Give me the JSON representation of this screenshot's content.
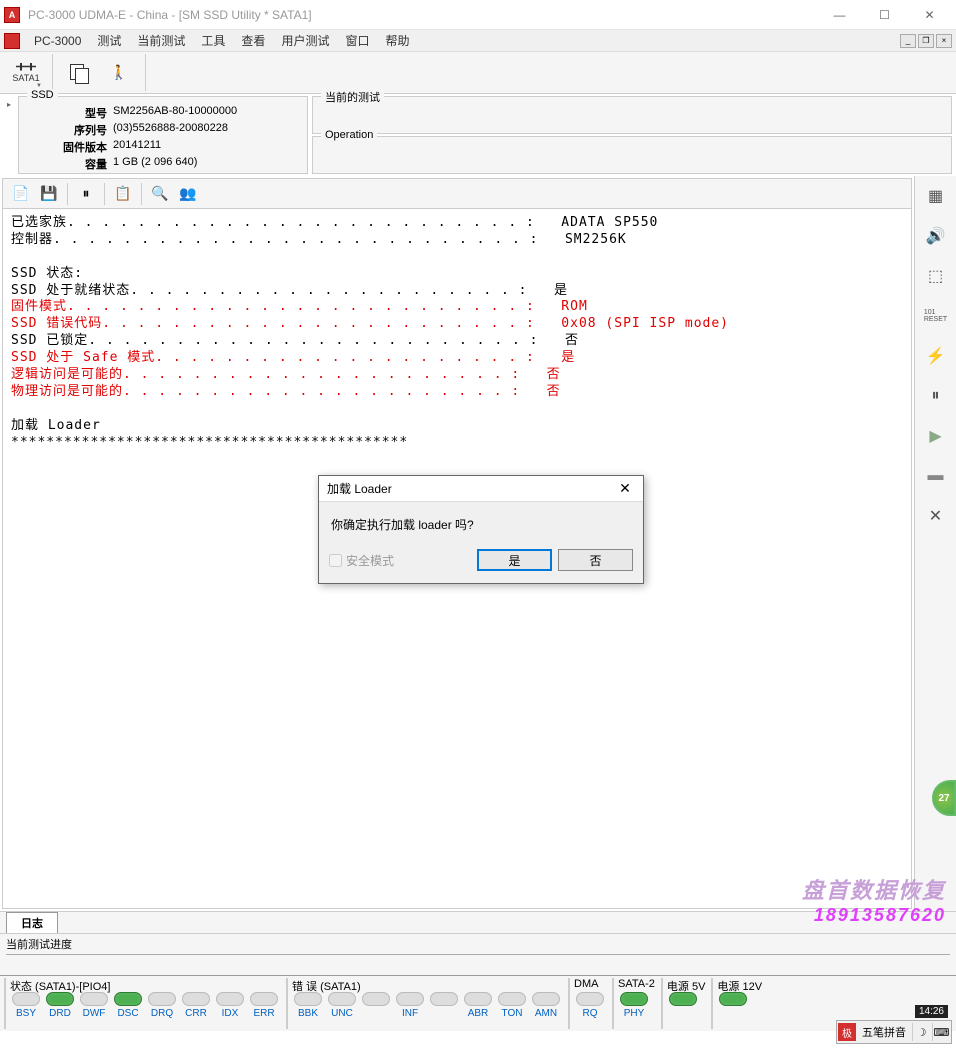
{
  "window": {
    "title": "PC-3000 UDMA-E - China - [SM SSD Utility * SATA1]",
    "minimize": "—",
    "maximize": "☐",
    "close": "✕"
  },
  "menubar": {
    "app_label": "PC-3000",
    "items": [
      "测试",
      "当前测试",
      "工具",
      "查看",
      "用户测试",
      "窗口",
      "帮助"
    ],
    "mdi_min": "_",
    "mdi_restore": "❐",
    "mdi_close": "×"
  },
  "toolbar": {
    "sata_label": "SATA1"
  },
  "ssd_info": {
    "panel_title": "SSD",
    "rows": [
      {
        "label": "型号",
        "value": "SM2256AB-80-10000000"
      },
      {
        "label": "序列号",
        "value": "(03)5526888-20080228"
      },
      {
        "label": "固件版本",
        "value": "20141211"
      },
      {
        "label": "容量",
        "value": "1 GB (2 096 640)"
      }
    ]
  },
  "test_panels": {
    "current_test": "当前的测试",
    "operation": "Operation"
  },
  "log": {
    "lines": [
      {
        "text": "已选家族. . . . . . . . . . . . . . . . . . . . . . . . . . :   ADATA SP550",
        "cls": ""
      },
      {
        "text": "控制器. . . . . . . . . . . . . . . . . . . . . . . . . . . :   SM2256K",
        "cls": ""
      },
      {
        "text": "",
        "cls": ""
      },
      {
        "text": "SSD 状态:",
        "cls": ""
      },
      {
        "text": "SSD 处于就绪状态. . . . . . . . . . . . . . . . . . . . . . :   是",
        "cls": ""
      },
      {
        "text": "固件模式. . . . . . . . . . . . . . . . . . . . . . . . . . :   ROM",
        "cls": "red"
      },
      {
        "text": "SSD 错误代码. . . . . . . . . . . . . . . . . . . . . . . . :   0x08 (SPI ISP mode)",
        "cls": "red"
      },
      {
        "text": "SSD 已锁定. . . . . . . . . . . . . . . . . . . . . . . . . :   否",
        "cls": ""
      },
      {
        "text": "SSD 处于 Safe 模式. . . . . . . . . . . . . . . . . . . . . :   是",
        "cls": "red"
      },
      {
        "text": "逻辑访问是可能的. . . . . . . . . . . . . . . . . . . . . . :   否",
        "cls": "red"
      },
      {
        "text": "物理访问是可能的. . . . . . . . . . . . . . . . . . . . . . :   否",
        "cls": "red"
      },
      {
        "text": "",
        "cls": ""
      },
      {
        "text": "加载 Loader",
        "cls": ""
      },
      {
        "text": "*********************************************",
        "cls": ""
      }
    ]
  },
  "tabs": {
    "log_tab": "日志"
  },
  "progress": {
    "title": "当前测试进度",
    "sub": ""
  },
  "statusbar": {
    "groups": [
      {
        "title": "状态 (SATA1)-[PIO4]",
        "inds": [
          {
            "label": "BSY",
            "on": false
          },
          {
            "label": "DRD",
            "on": true
          },
          {
            "label": "DWF",
            "on": false
          },
          {
            "label": "DSC",
            "on": true
          },
          {
            "label": "DRQ",
            "on": false
          },
          {
            "label": "CRR",
            "on": false
          },
          {
            "label": "IDX",
            "on": false
          },
          {
            "label": "ERR",
            "on": false
          }
        ]
      },
      {
        "title": "错 误 (SATA1)",
        "inds": [
          {
            "label": "BBK",
            "on": false
          },
          {
            "label": "UNC",
            "on": false
          },
          {
            "label": "",
            "on": false
          },
          {
            "label": "INF",
            "on": false
          },
          {
            "label": "",
            "on": false
          },
          {
            "label": "ABR",
            "on": false
          },
          {
            "label": "TON",
            "on": false
          },
          {
            "label": "AMN",
            "on": false
          }
        ]
      },
      {
        "title": "DMA",
        "inds": [
          {
            "label": "RQ",
            "on": false
          }
        ]
      },
      {
        "title": "SATA-2",
        "inds": [
          {
            "label": "PHY",
            "on": true
          }
        ]
      },
      {
        "title": "电源 5V",
        "inds": [
          {
            "label": "",
            "on": true
          }
        ]
      },
      {
        "title": "电源 12V",
        "inds": [
          {
            "label": "",
            "on": true
          }
        ]
      }
    ]
  },
  "dialog": {
    "title": "加载 Loader",
    "message": "你确定执行加载 loader 吗?",
    "checkbox_label": "安全模式",
    "btn_yes": "是",
    "btn_no": "否",
    "close": "✕"
  },
  "watermark": {
    "line1": "盘首数据恢复",
    "line2": "18913587620"
  },
  "badge": {
    "text": "27"
  },
  "ime": {
    "icon": "极",
    "label": "五笔拼音",
    "moon": "☽",
    "kbd": "⌨"
  },
  "clock": "14:26"
}
